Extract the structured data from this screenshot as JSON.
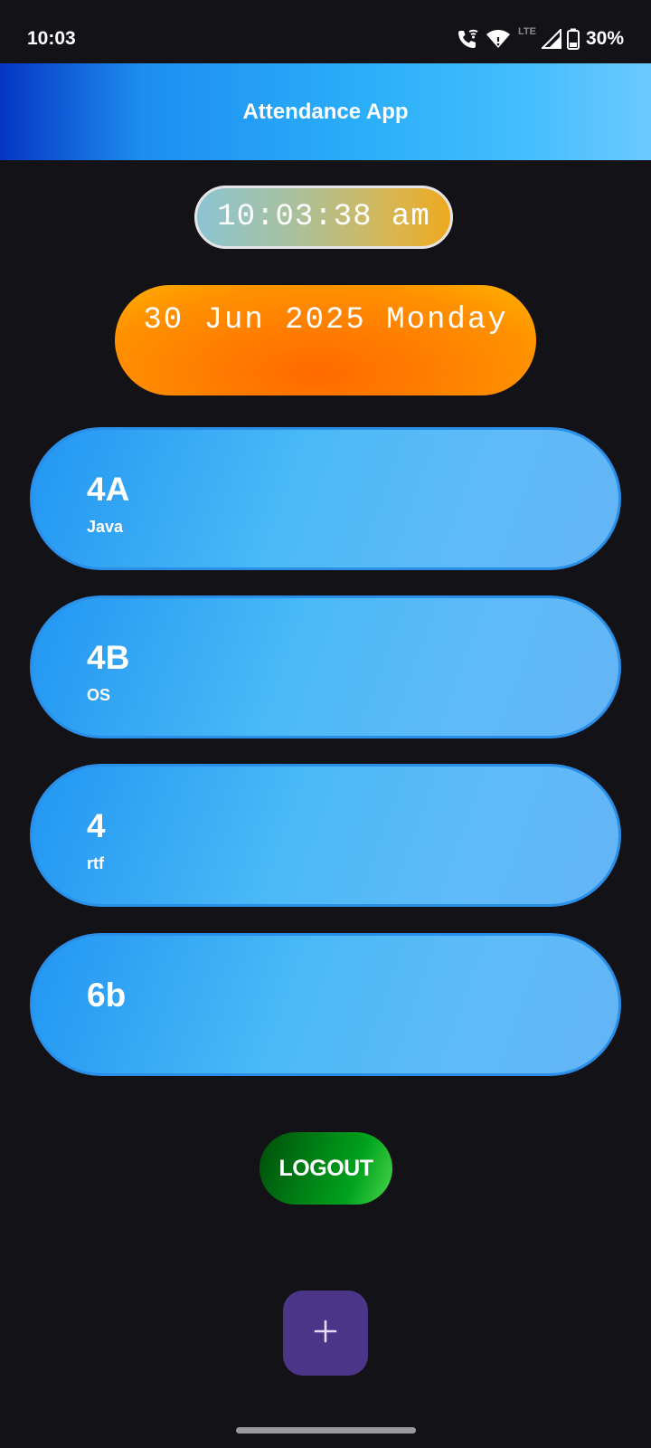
{
  "status_bar": {
    "time": "10:03",
    "network_type": "LTE",
    "battery": "30%",
    "icons": [
      "wifi-calling-icon",
      "wifi-icon",
      "signal-icon",
      "battery-icon"
    ]
  },
  "app_bar": {
    "title": "Attendance App"
  },
  "clock": {
    "time": "10:03:38 am"
  },
  "date": {
    "text": "30 Jun 2025 Monday"
  },
  "classes": [
    {
      "title": "4A",
      "subject": "Java"
    },
    {
      "title": "4B",
      "subject": "OS"
    },
    {
      "title": "4",
      "subject": "rtf"
    },
    {
      "title": "6b",
      "subject": ""
    }
  ],
  "logout": {
    "label": "LOGOUT"
  },
  "fab": {
    "icon": "plus-icon"
  },
  "colors": {
    "background": "#131217",
    "card_blue": "#2296f3",
    "logout_green": "#00a21d",
    "fab_purple": "#4a3589",
    "date_orange": "#ff7d00"
  }
}
